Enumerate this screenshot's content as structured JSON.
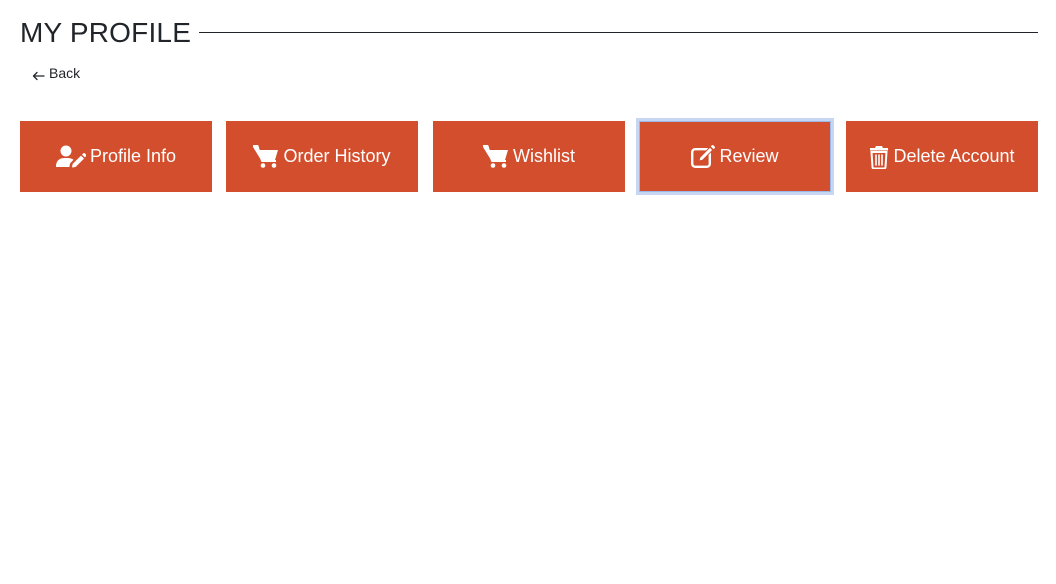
{
  "header": {
    "title": "MY PROFILE"
  },
  "nav": {
    "back_label": "Back",
    "back_icon": "arrow-left-icon"
  },
  "tabs": [
    {
      "label": "Profile Info",
      "icon": "user-edit-icon",
      "selected": false
    },
    {
      "label": "Order History",
      "icon": "shopping-cart-icon",
      "selected": false
    },
    {
      "label": "Wishlist",
      "icon": "shopping-cart-icon",
      "selected": false
    },
    {
      "label": "Review",
      "icon": "edit-icon",
      "selected": true
    },
    {
      "label": "Delete Account",
      "icon": "trash-icon",
      "selected": false
    }
  ],
  "colors": {
    "tab_background": "#d24e2d",
    "tab_text": "#ffffff",
    "focus_ring": "#c7d7f3",
    "title_text": "#212529"
  }
}
